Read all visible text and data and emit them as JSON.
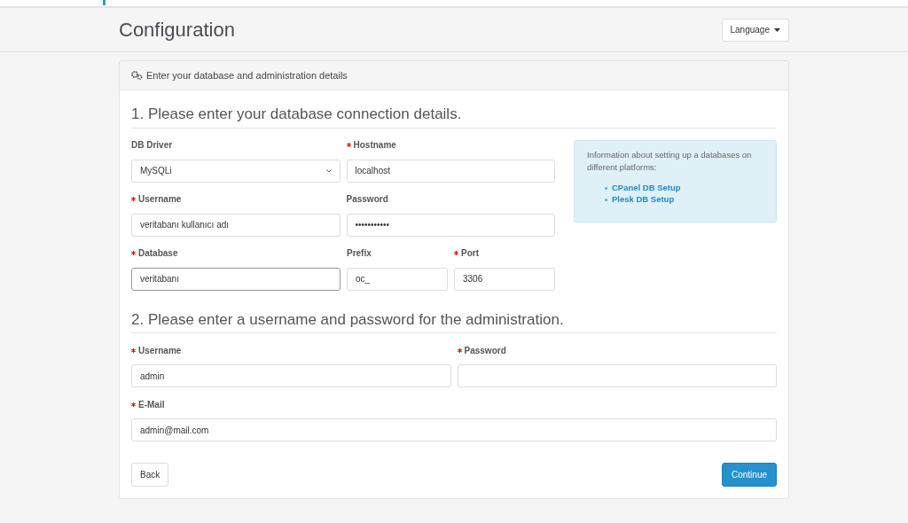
{
  "page_title": "Configuration",
  "language_button": "Language",
  "panel_heading": "Enter your database and administration details",
  "sections": [
    {
      "title": "1. Please enter your database connection details.",
      "rows": [
        [
          {
            "label": "DB Driver",
            "required": false,
            "kind": "select",
            "value": "MySQLi",
            "focused": false
          },
          {
            "label": "Hostname",
            "required": true,
            "kind": "text",
            "value": "localhost",
            "focused": false
          }
        ],
        [
          {
            "label": "Username",
            "required": true,
            "kind": "text",
            "value": "veritabanı kullanıcı adı",
            "focused": false
          },
          {
            "label": "Password",
            "required": false,
            "kind": "text",
            "value": "•••••••••••",
            "focused": false
          }
        ],
        [
          {
            "label": "Database",
            "required": true,
            "kind": "text",
            "value": "veritabanı",
            "focused": true
          },
          {
            "label": "Prefix",
            "required": false,
            "kind": "text",
            "value": "oc_",
            "focused": false
          },
          {
            "label": "Port",
            "required": true,
            "kind": "text",
            "value": "3306",
            "focused": false
          }
        ]
      ],
      "info": {
        "text": "Information about setting up a databases on different platforms:",
        "links": [
          "CPanel DB Setup",
          "Plesk DB Setup"
        ]
      }
    },
    {
      "title": "2. Please enter a username and password for the administration.",
      "rows": [
        [
          {
            "label": "Username",
            "required": true,
            "kind": "text",
            "value": "admin",
            "focused": false
          },
          {
            "label": "Password",
            "required": true,
            "kind": "text",
            "focused": false
          }
        ],
        [
          {
            "label": "E-Mail",
            "required": true,
            "kind": "text",
            "value": "admin@mail.com",
            "focused": false
          }
        ]
      ]
    }
  ],
  "buttons": {
    "back": "Back",
    "continue": "Continue"
  }
}
